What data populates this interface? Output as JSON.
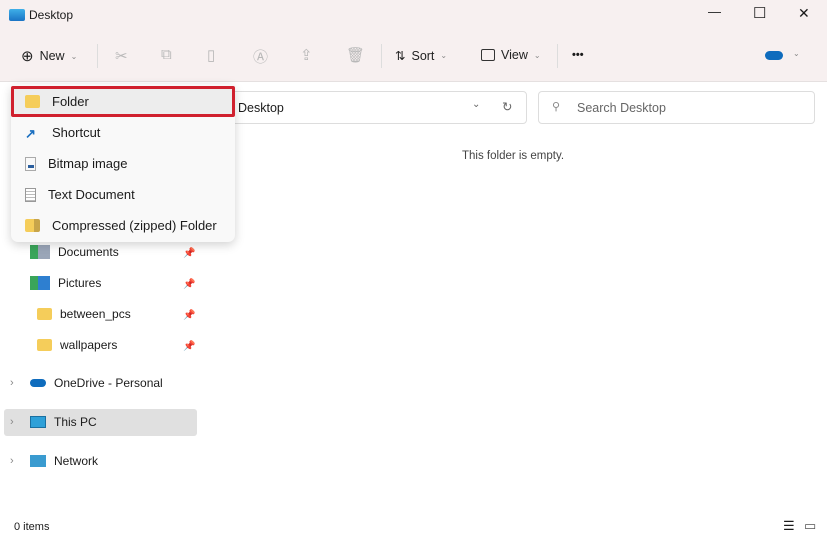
{
  "window": {
    "title": "Desktop",
    "minimize": "—",
    "maximize": "☐",
    "close": "✕"
  },
  "toolbar": {
    "new_label": "New",
    "sort_label": "Sort",
    "view_label": "View",
    "more_label": "•••"
  },
  "address": {
    "path": "Desktop",
    "search_placeholder": "Search Desktop"
  },
  "new_menu": {
    "items": [
      {
        "label": "Folder",
        "highlighted": true
      },
      {
        "label": "Shortcut"
      },
      {
        "label": "Bitmap image"
      },
      {
        "label": "Text Document"
      },
      {
        "label": "Compressed (zipped) Folder"
      }
    ],
    "highlight_color": "#d0202e"
  },
  "nav": {
    "quick": [
      {
        "label": "Documents"
      },
      {
        "label": "Pictures"
      },
      {
        "label": "between_pcs"
      },
      {
        "label": "wallpapers"
      }
    ],
    "roots": [
      {
        "label": "OneDrive - Personal"
      },
      {
        "label": "This PC",
        "selected": true
      },
      {
        "label": "Network"
      }
    ]
  },
  "content": {
    "empty_text": "This folder is empty."
  },
  "status": {
    "items_count": "0 items"
  }
}
